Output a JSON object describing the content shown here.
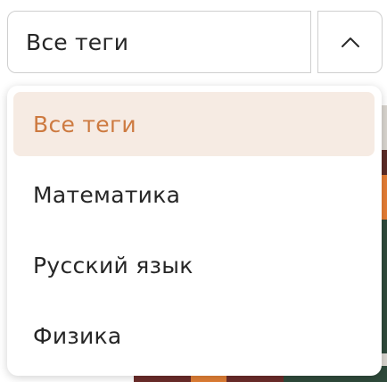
{
  "select": {
    "value": "Все теги",
    "toggle_icon": "chevron-up-icon"
  },
  "menu": {
    "items": [
      {
        "label": "Все теги",
        "selected": true
      },
      {
        "label": "Математика",
        "selected": false
      },
      {
        "label": "Русский язык",
        "selected": false
      },
      {
        "label": "Физика",
        "selected": false
      }
    ]
  },
  "colors": {
    "selected_bg": "#f6ebe3",
    "selected_text": "#cd7a40",
    "text": "#262626",
    "border": "#cfcfcf"
  }
}
